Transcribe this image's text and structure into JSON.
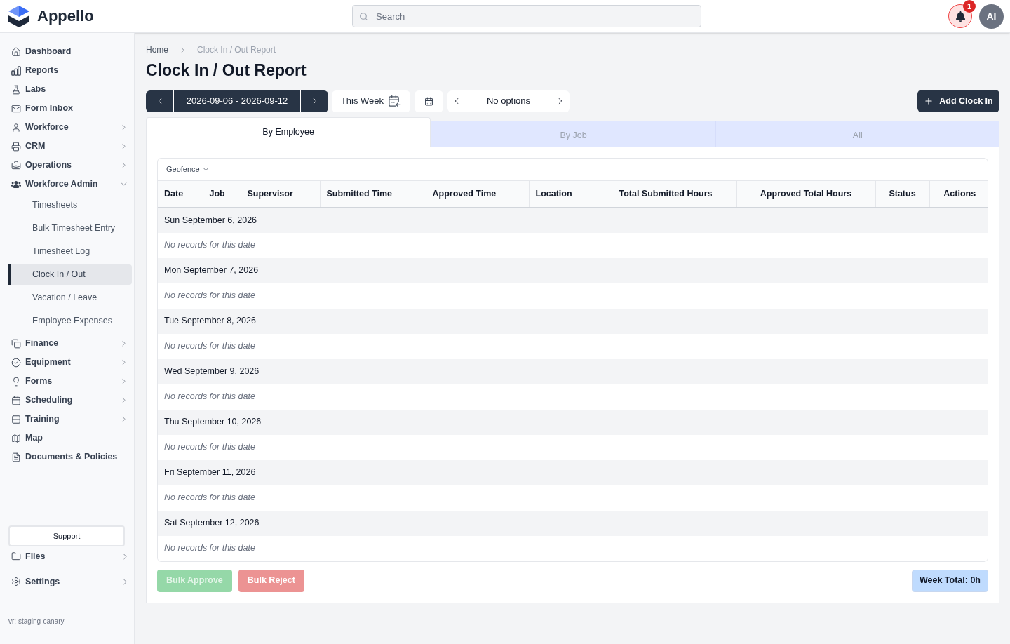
{
  "app": {
    "name": "Appello"
  },
  "search": {
    "placeholder": "Search"
  },
  "notifications": {
    "badge": "1"
  },
  "user": {
    "initials": "AI"
  },
  "sidebar": {
    "items": [
      {
        "label": "Dashboard",
        "kind": "link"
      },
      {
        "label": "Reports",
        "kind": "link"
      },
      {
        "label": "Labs",
        "kind": "link"
      },
      {
        "label": "Form Inbox",
        "kind": "link"
      },
      {
        "label": "Workforce",
        "kind": "group",
        "expanded": false
      },
      {
        "label": "CRM",
        "kind": "group",
        "expanded": false
      },
      {
        "label": "Operations",
        "kind": "group",
        "expanded": false
      },
      {
        "label": "Workforce Admin",
        "kind": "group",
        "expanded": true,
        "children": [
          {
            "label": "Timesheets",
            "selected": false
          },
          {
            "label": "Bulk Timesheet Entry",
            "selected": false
          },
          {
            "label": "Timesheet Log",
            "selected": false
          },
          {
            "label": "Clock In / Out",
            "selected": true
          },
          {
            "label": "Vacation / Leave",
            "selected": false
          },
          {
            "label": "Employee Expenses",
            "selected": false
          }
        ]
      },
      {
        "label": "Finance",
        "kind": "group",
        "expanded": false
      },
      {
        "label": "Equipment",
        "kind": "group",
        "expanded": false
      },
      {
        "label": "Forms",
        "kind": "group",
        "expanded": false
      },
      {
        "label": "Scheduling",
        "kind": "group",
        "expanded": false
      },
      {
        "label": "Training",
        "kind": "group",
        "expanded": false
      },
      {
        "label": "Map",
        "kind": "link"
      },
      {
        "label": "Documents & Policies",
        "kind": "link"
      }
    ],
    "support_button": "Support",
    "bottom_items": [
      {
        "label": "Files",
        "kind": "group",
        "expanded": false
      },
      {
        "label": "Settings",
        "kind": "group",
        "expanded": false
      }
    ],
    "version": "vr: staging-canary"
  },
  "breadcrumb": [
    {
      "label": "Home",
      "current": false
    },
    {
      "label": "Clock In / Out Report",
      "current": true
    }
  ],
  "page_title": "Clock In / Out Report",
  "toolbar": {
    "date_range": "2026-09-06 - 2026-09-12",
    "this_week_button": "This Week",
    "option_picker": "No options",
    "add_button": "Add Clock In"
  },
  "tabs": [
    {
      "label": "By Employee",
      "selected": true
    },
    {
      "label": "By Job",
      "selected": false
    },
    {
      "label": "All",
      "selected": false
    }
  ],
  "filter": {
    "label": "Geofence"
  },
  "table": {
    "columns": [
      "Date",
      "Job",
      "Supervisor",
      "Submitted Time",
      "Approved Time",
      "Location",
      "Total Submitted Hours",
      "Approved Total Hours",
      "Status",
      "Actions"
    ],
    "groups": [
      {
        "date": "Sun September 6, 2026",
        "message": "No records for this date"
      },
      {
        "date": "Mon September 7, 2026",
        "message": "No records for this date"
      },
      {
        "date": "Tue September 8, 2026",
        "message": "No records for this date"
      },
      {
        "date": "Wed September 9, 2026",
        "message": "No records for this date"
      },
      {
        "date": "Thu September 10, 2026",
        "message": "No records for this date"
      },
      {
        "date": "Fri September 11, 2026",
        "message": "No records for this date"
      },
      {
        "date": "Sat September 12, 2026",
        "message": "No records for this date"
      }
    ]
  },
  "actions": [
    {
      "label": "Bulk Approve",
      "kind": "approve",
      "disabled": true
    },
    {
      "label": "Bulk Reject",
      "kind": "reject",
      "disabled": true
    }
  ],
  "week_total": "Week Total: 0h"
}
